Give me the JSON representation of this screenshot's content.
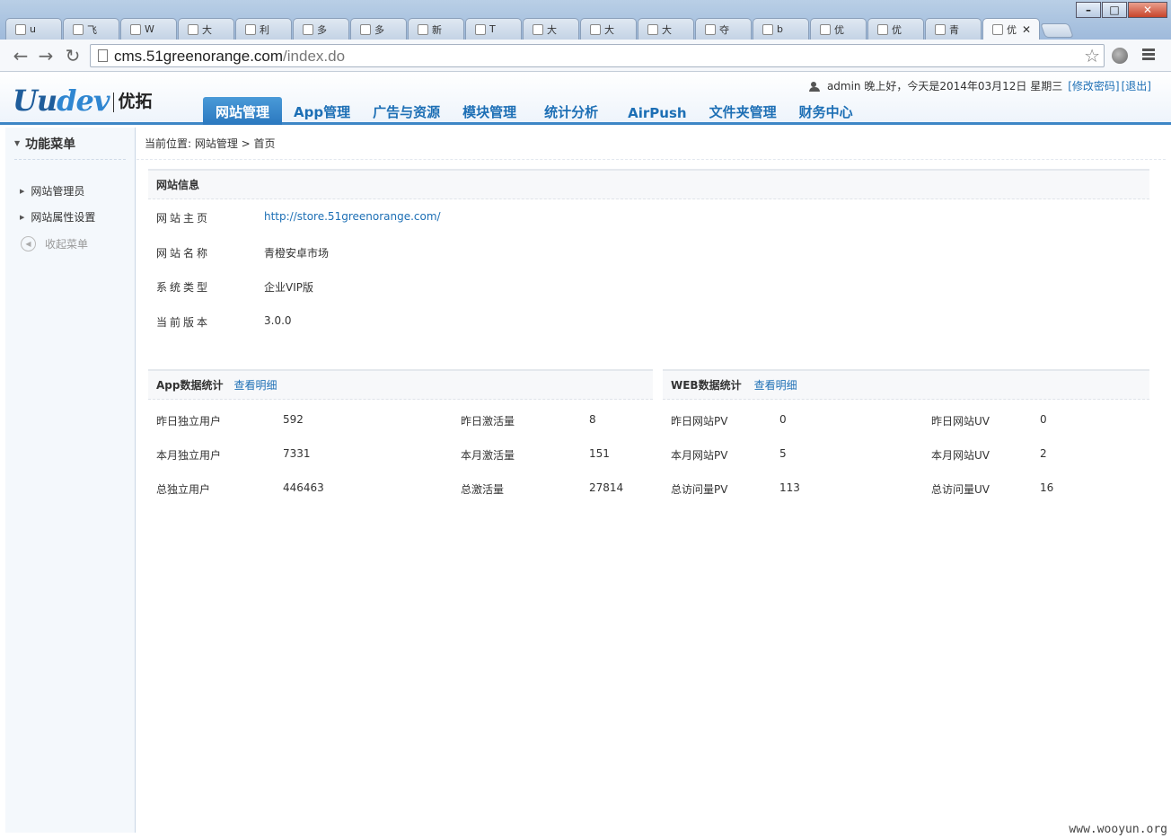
{
  "browser": {
    "tabs": [
      {
        "label": "u"
      },
      {
        "label": "飞"
      },
      {
        "label": "W"
      },
      {
        "label": "大"
      },
      {
        "label": "利"
      },
      {
        "label": "多"
      },
      {
        "label": "多"
      },
      {
        "label": "新"
      },
      {
        "label": "T"
      },
      {
        "label": "大"
      },
      {
        "label": "大"
      },
      {
        "label": "大"
      },
      {
        "label": "夺"
      },
      {
        "label": "b"
      },
      {
        "label": "优"
      },
      {
        "label": "优"
      },
      {
        "label": "青"
      },
      {
        "label": "优"
      }
    ],
    "url_host": "cms.51greenorange.com",
    "url_path": "/index.do"
  },
  "header": {
    "logo_brand_a": "Uu",
    "logo_brand_b": "dev",
    "logo_cn": "优拓",
    "greeting": "admin 晚上好，今天是2014年03月12日 星期三",
    "change_password": "[修改密码]",
    "logout": "[退出]",
    "nav": [
      {
        "label": "网站管理"
      },
      {
        "label": "App管理"
      },
      {
        "label": "广告与资源"
      },
      {
        "label": "模块管理"
      },
      {
        "label": "统计分析"
      },
      {
        "label": "AirPush"
      },
      {
        "label": "文件夹管理"
      },
      {
        "label": "财务中心"
      }
    ]
  },
  "sidebar": {
    "title": "功能菜单",
    "items": [
      {
        "label": "网站管理员"
      },
      {
        "label": "网站属性设置"
      }
    ],
    "collapse": "收起菜单"
  },
  "breadcrumb": "当前位置: 网站管理 > 首页",
  "site_info": {
    "title": "网站信息",
    "rows": [
      {
        "label": "网站主页",
        "value": "http://store.51greenorange.com/"
      },
      {
        "label": "网站名称",
        "value": "青橙安卓市场"
      },
      {
        "label": "系统类型",
        "value": "企业VIP版"
      },
      {
        "label": "当前版本",
        "value": "3.0.0"
      }
    ]
  },
  "app_stats": {
    "title": "App数据统计",
    "detail": "查看明细",
    "rows": [
      {
        "l1": "昨日独立用户",
        "v1": "592",
        "l2": "昨日激活量",
        "v2": "8"
      },
      {
        "l1": "本月独立用户",
        "v1": "7331",
        "l2": "本月激活量",
        "v2": "151"
      },
      {
        "l1": "总独立用户",
        "v1": "446463",
        "l2": "总激活量",
        "v2": "27814"
      }
    ]
  },
  "web_stats": {
    "title": "WEB数据统计",
    "detail": "查看明细",
    "rows": [
      {
        "l1": "昨日网站PV",
        "v1": "0",
        "l2": "昨日网站UV",
        "v2": "0"
      },
      {
        "l1": "本月网站PV",
        "v1": "5",
        "l2": "本月网站UV",
        "v2": "2"
      },
      {
        "l1": "总访问量PV",
        "v1": "113",
        "l2": "总访问量UV",
        "v2": "16"
      }
    ]
  },
  "watermark": "www.wooyun.org"
}
